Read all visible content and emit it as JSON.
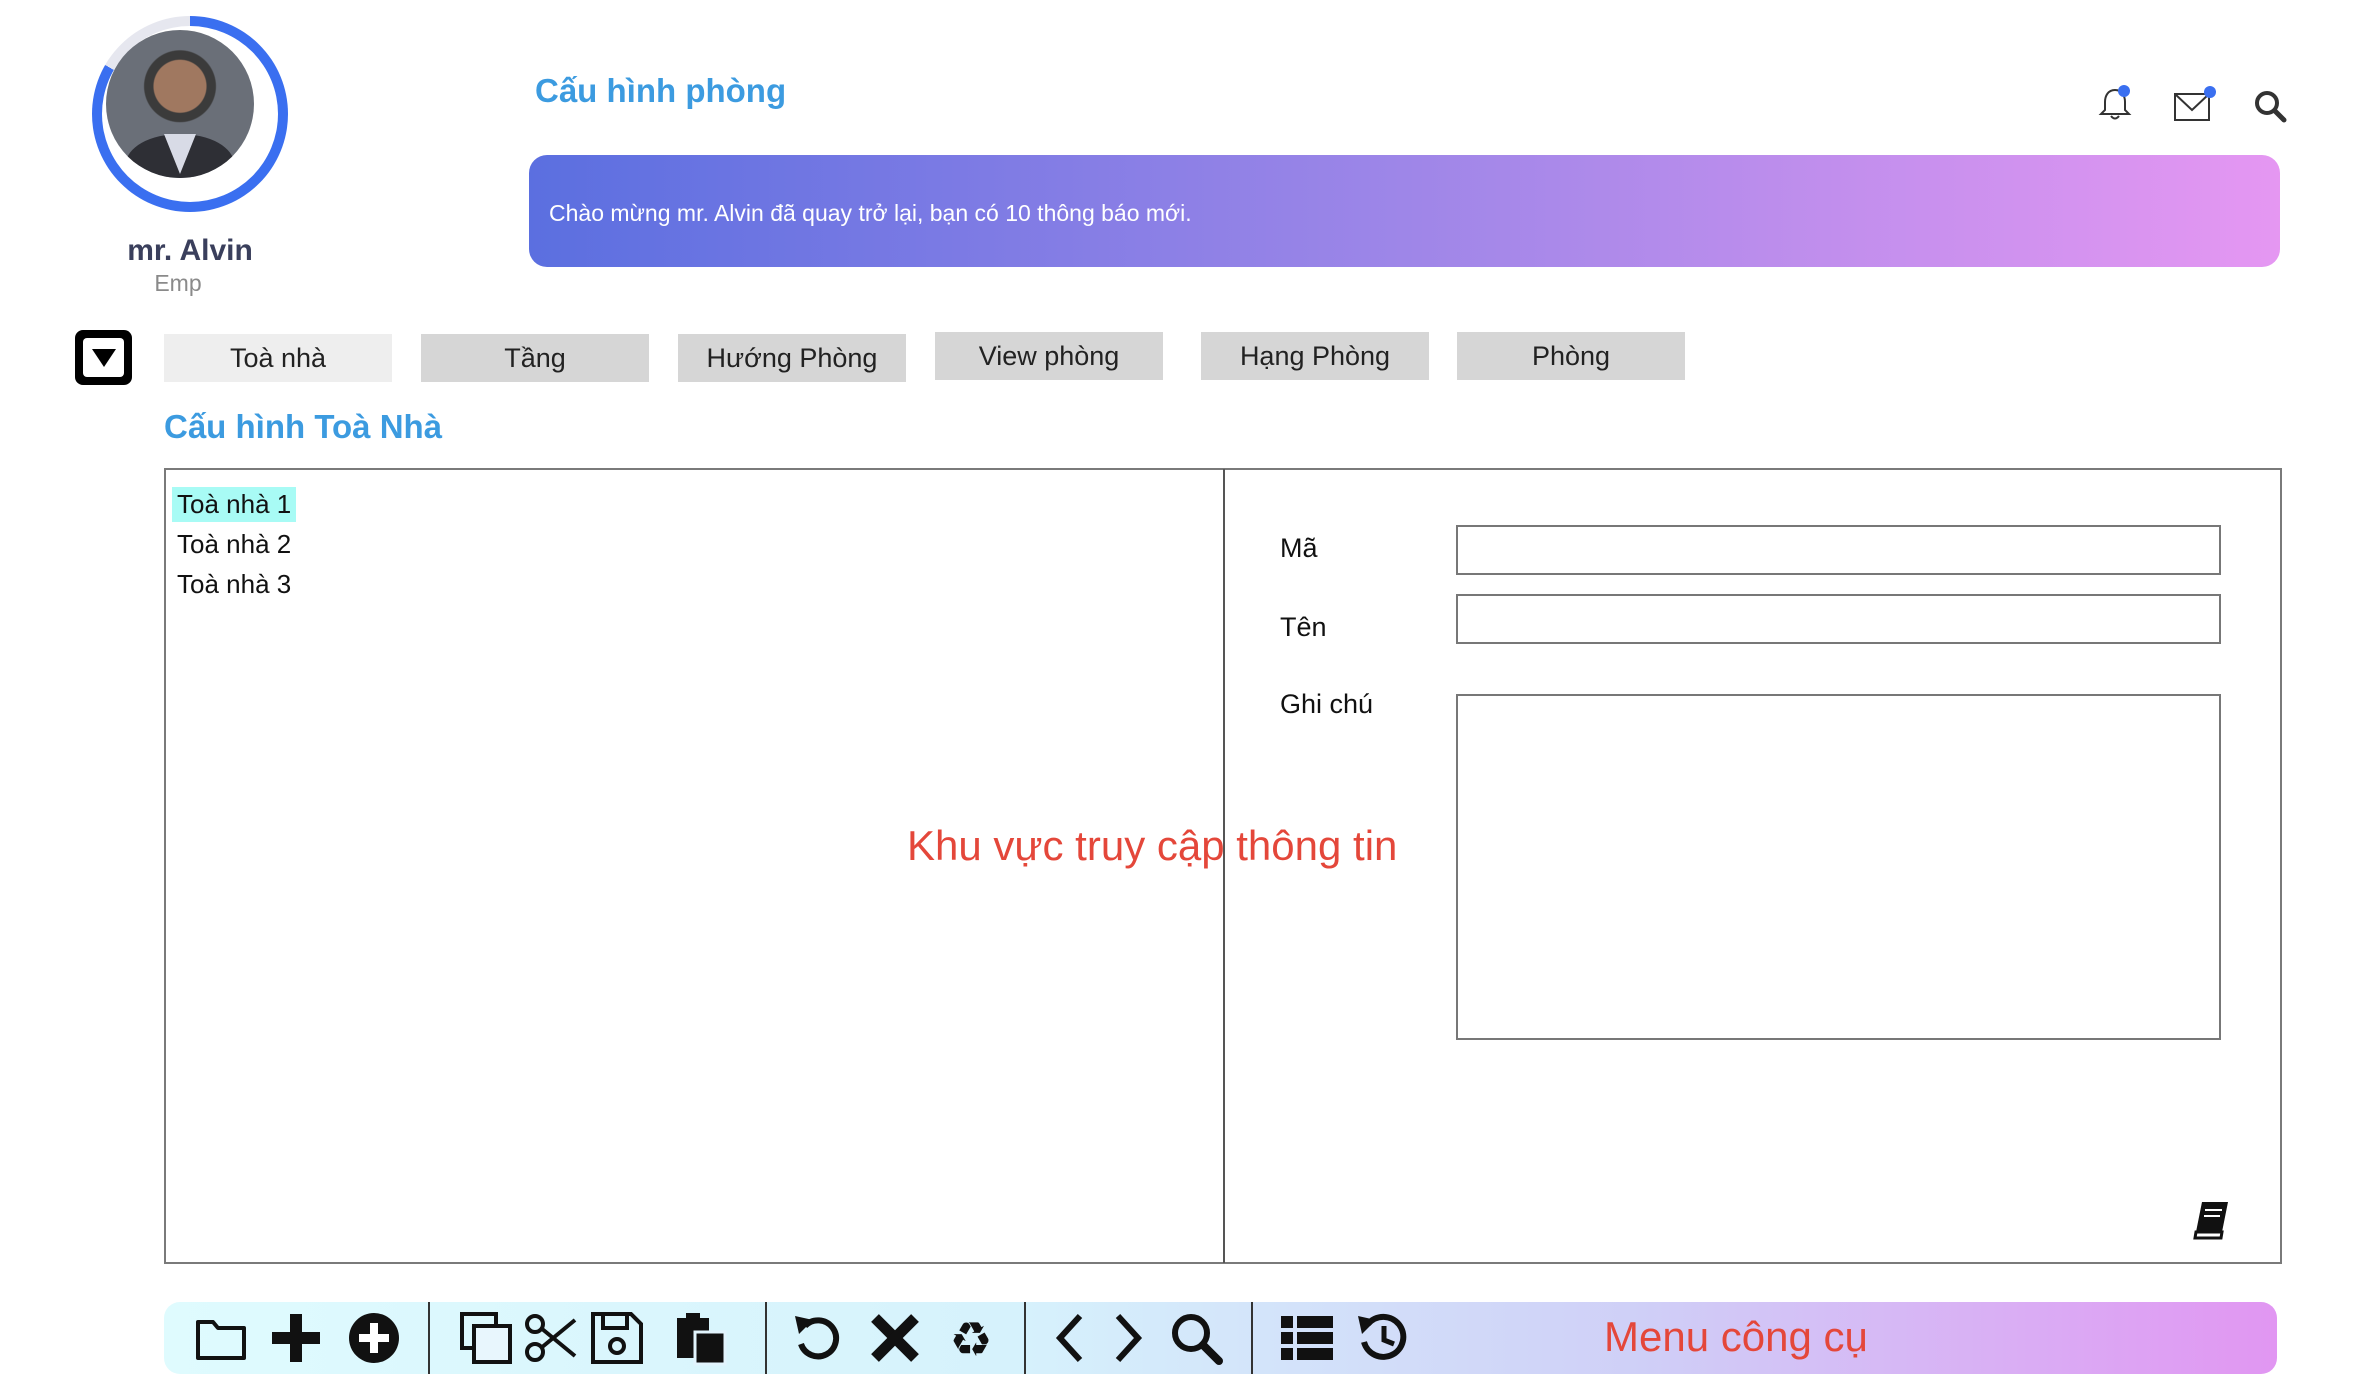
{
  "user": {
    "name": "mr. Alvin",
    "role": "Emp"
  },
  "header": {
    "title": "Cấu hình phòng",
    "welcome": "Chào mừng mr. Alvin đã quay trở lại, bạn có 10 thông báo mới.",
    "icons": [
      "bell-icon",
      "mail-icon",
      "search-icon"
    ],
    "accent": "#3c9be0",
    "badge_color": "#3a6ff0"
  },
  "tabs": [
    {
      "label": "Toà nhà",
      "active": true
    },
    {
      "label": "Tầng"
    },
    {
      "label": "Hướng Phòng"
    },
    {
      "label": "View phòng"
    },
    {
      "label": "Hạng Phòng"
    },
    {
      "label": "Phòng"
    }
  ],
  "section": {
    "title": "Cấu hình Toà Nhà"
  },
  "list": {
    "items": [
      "Toà nhà 1",
      "Toà nhà 2",
      "Toà nhà 3"
    ],
    "selected_index": 0
  },
  "form": {
    "code_label": "Mã",
    "code_value": "",
    "name_label": "Tên",
    "name_value": "",
    "note_label": "Ghi chú",
    "note_value": ""
  },
  "annotations": {
    "info_area": "Khu vực truy cập thông tin",
    "toolbar": "Menu công cụ",
    "color": "#e4473a"
  },
  "toolbar": {
    "tools": [
      "folder-icon",
      "plus-icon",
      "add-circle-icon",
      "copy-icon",
      "cut-icon",
      "save-icon",
      "paste-icon",
      "undo-icon",
      "close-icon",
      "recycle-icon",
      "chevron-left-icon",
      "chevron-right-icon",
      "search-icon",
      "list-icon",
      "history-icon"
    ]
  }
}
